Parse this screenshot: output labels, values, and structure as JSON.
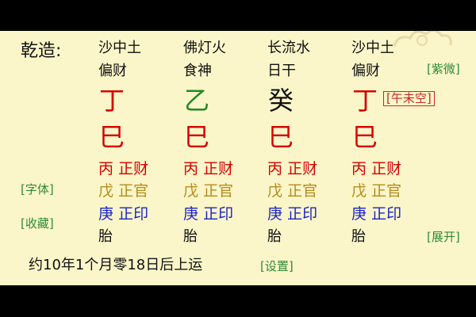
{
  "header": {
    "title": "乾造:"
  },
  "pillars": [
    {
      "nayin": "沙中土",
      "shishen": "偏财",
      "stem": "丁",
      "stem_color": "#d50000",
      "branch": "巳",
      "hidden": [
        {
          "gan": "丙",
          "god": "正财"
        },
        {
          "gan": "戊",
          "god": "正官"
        },
        {
          "gan": "庚",
          "god": "正印"
        }
      ],
      "state": "胎"
    },
    {
      "nayin": "佛灯火",
      "shishen": "食神",
      "stem": "乙",
      "stem_color": "#1e8a24",
      "branch": "巳",
      "hidden": [
        {
          "gan": "丙",
          "god": "正财"
        },
        {
          "gan": "戊",
          "god": "正官"
        },
        {
          "gan": "庚",
          "god": "正印"
        }
      ],
      "state": "胎"
    },
    {
      "nayin": "长流水",
      "shishen": "日干",
      "stem": "癸",
      "stem_color": "#111111",
      "branch": "巳",
      "hidden": [
        {
          "gan": "丙",
          "god": "正财"
        },
        {
          "gan": "戊",
          "god": "正官"
        },
        {
          "gan": "庚",
          "god": "正印"
        }
      ],
      "state": "胎"
    },
    {
      "nayin": "沙中土",
      "shishen": "偏财",
      "stem": "丁",
      "stem_color": "#d50000",
      "branch": "巳",
      "hidden": [
        {
          "gan": "丙",
          "god": "正财"
        },
        {
          "gan": "戊",
          "god": "正官"
        },
        {
          "gan": "庚",
          "god": "正印"
        }
      ],
      "state": "胎"
    }
  ],
  "kongwang": "[午未空]",
  "actions": {
    "purple": "[紫微]",
    "font": "[字体]",
    "favorite": "[收藏]",
    "expand": "[展开]",
    "settings": "[设置]"
  },
  "footer": {
    "text": "约10年1个月零18日后上运"
  },
  "colors": {
    "background": "#fbf6c9",
    "red": "#d50000",
    "green": "#1e8a24",
    "brown": "#b88a1c",
    "blue": "#1a24c8",
    "link": "#2e8b3a"
  }
}
